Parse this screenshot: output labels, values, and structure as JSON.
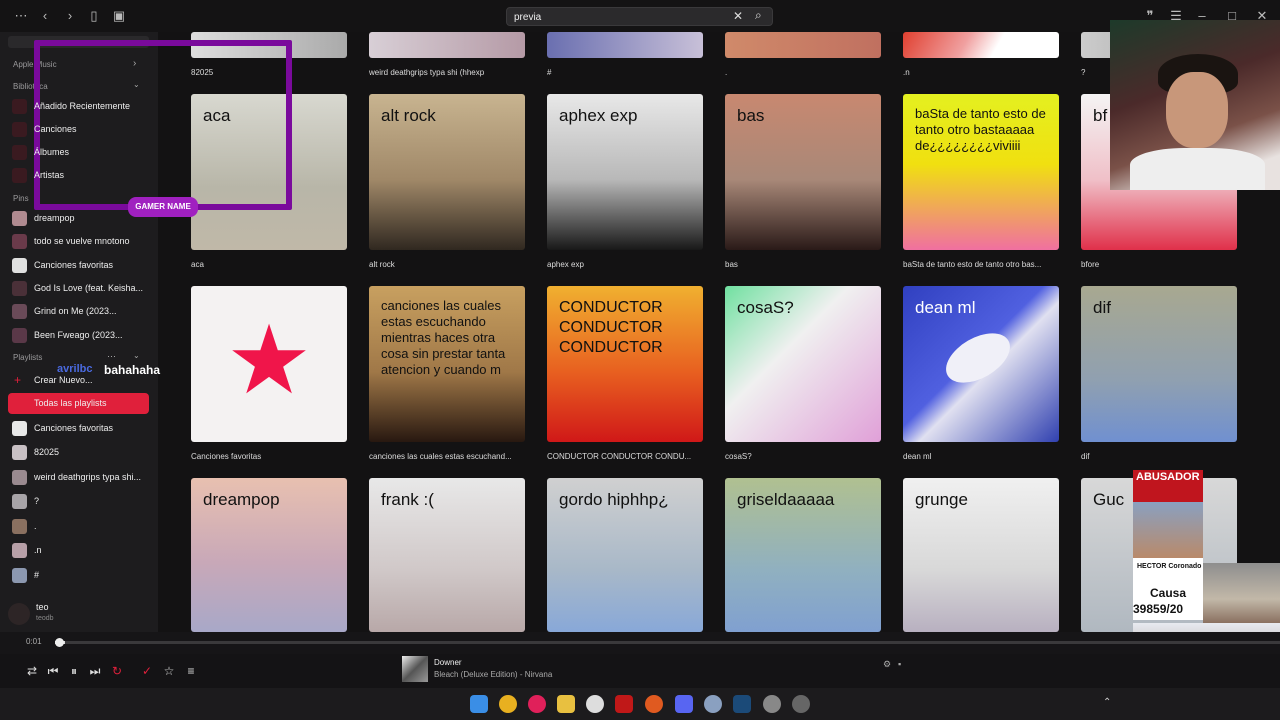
{
  "search": {
    "value": "previa"
  },
  "sidebar": {
    "apple_music": "Apple Music",
    "library_head": "Biblioteca",
    "library": [
      {
        "label": "Añadido Recientemente"
      },
      {
        "label": "Canciones"
      },
      {
        "label": "Álbumes"
      },
      {
        "label": "Artistas"
      }
    ],
    "pins_head": "Pins",
    "pins": [
      {
        "label": "dreampop"
      },
      {
        "label": "todo se vuelve mnotono"
      },
      {
        "label": "Canciones favoritas"
      },
      {
        "label": "God Is Love (feat. Keisha..."
      },
      {
        "label": "Grind on Me (2023..."
      },
      {
        "label": "Been Fweago (2023..."
      }
    ],
    "playlists_head": "Playlists",
    "create": "Crear Nuevo...",
    "playlists": [
      {
        "label": "Todas las playlists",
        "active": true
      },
      {
        "label": "Canciones favoritas"
      },
      {
        "label": "82025"
      },
      {
        "label": "weird deathgrips typa shi..."
      },
      {
        "label": "?"
      },
      {
        "label": "."
      },
      {
        "label": ".n"
      },
      {
        "label": "#"
      }
    ],
    "user": {
      "name": "teo",
      "handle": "teodb"
    }
  },
  "top_row_captions": [
    "82025",
    "weird deathgrips typa shi (hhexp",
    "#",
    ".",
    ".n",
    "?"
  ],
  "rows": [
    [
      {
        "title": "aca",
        "caption": "aca"
      },
      {
        "title": "alt rock",
        "caption": "alt rock"
      },
      {
        "title": "aphex exp",
        "caption": "aphex exp"
      },
      {
        "title": "bas",
        "caption": "bas"
      },
      {
        "title": "baSta de tanto esto de tanto otro bastaaaaa de¿¿¿¿¿¿¿¿viviiii",
        "caption": "baSta de tanto esto de tanto otro bas..."
      },
      {
        "title": "bf",
        "caption": "bfore"
      }
    ],
    [
      {
        "title": "",
        "caption": "Canciones favoritas"
      },
      {
        "title": "canciones las cuales estas escuchando mientras haces otra cosa sin prestar tanta atencion y cuando m",
        "caption": "canciones las cuales estas escuchand..."
      },
      {
        "title": "CONDUCTOR CONDUCTOR CONDUCTOR",
        "caption": "CONDUCTOR CONDUCTOR CONDU..."
      },
      {
        "title": "cosaS?",
        "caption": "cosaS?"
      },
      {
        "title": "dean ml",
        "caption": "dean ml"
      },
      {
        "title": "dif",
        "caption": "dif"
      }
    ],
    [
      {
        "title": "dreampop"
      },
      {
        "title": "frank :("
      },
      {
        "title": "gordo hiphhp¿"
      },
      {
        "title": "griseldaaaaa"
      },
      {
        "title": "grunge"
      },
      {
        "title": "Guc"
      }
    ]
  ],
  "overlays": {
    "gamer_name": "GAMER NAME",
    "chat_user": "avrilbc",
    "chat_msg": "bahahaha",
    "news_head": "ABUSADOR PROCESAD",
    "news_name": "HECTOR Coronado",
    "news_causa": "Causa",
    "news_num": "39859/20"
  },
  "player": {
    "time": "0:01",
    "progress": 0.008,
    "track": "Downer",
    "album_artist": "Bleach (Deluxe Edition) - Nirvana"
  }
}
